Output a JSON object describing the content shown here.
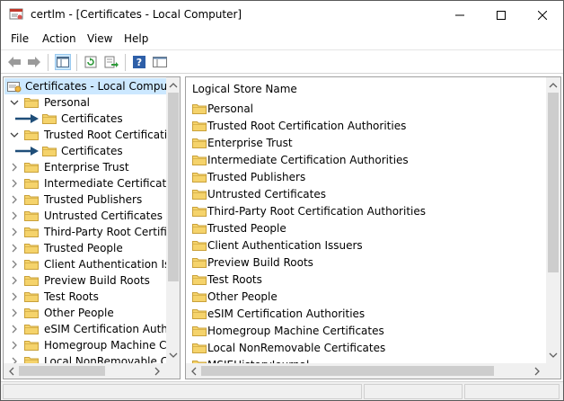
{
  "window": {
    "title": "certlm - [Certificates - Local Computer]"
  },
  "menu": {
    "file": "File",
    "action": "Action",
    "view": "View",
    "help": "Help"
  },
  "toolbar": {
    "icons": [
      "back-arrow-icon",
      "forward-arrow-icon",
      "show-tree-icon",
      "refresh-icon",
      "export-list-icon",
      "help-icon",
      "properties-icon"
    ]
  },
  "tree": {
    "root": "Certificates - Local Computer",
    "items": [
      {
        "label": "Personal",
        "expanded": true
      },
      {
        "label": "Certificates",
        "child": true,
        "annotated": true
      },
      {
        "label": "Trusted Root Certification",
        "expanded": true
      },
      {
        "label": "Certificates",
        "child": true,
        "annotated": true
      },
      {
        "label": "Enterprise Trust"
      },
      {
        "label": "Intermediate Certification"
      },
      {
        "label": "Trusted Publishers"
      },
      {
        "label": "Untrusted Certificates"
      },
      {
        "label": "Third-Party Root Certificat"
      },
      {
        "label": "Trusted People"
      },
      {
        "label": "Client Authentication Issu"
      },
      {
        "label": "Preview Build Roots"
      },
      {
        "label": "Test Roots"
      },
      {
        "label": "Other People"
      },
      {
        "label": "eSIM Certification Authori"
      },
      {
        "label": "Homegroup Machine Cer"
      },
      {
        "label": "Local NonRemovable Certi"
      }
    ]
  },
  "list": {
    "column_header": "Logical Store Name",
    "items": [
      "Personal",
      "Trusted Root Certification Authorities",
      "Enterprise Trust",
      "Intermediate Certification Authorities",
      "Trusted Publishers",
      "Untrusted Certificates",
      "Third-Party Root Certification Authorities",
      "Trusted People",
      "Client Authentication Issuers",
      "Preview Build Roots",
      "Test Roots",
      "Other People",
      "eSIM Certification Authorities",
      "Homegroup Machine Certificates",
      "Local NonRemovable Certificates",
      "MSIEHistoryJournal"
    ]
  },
  "colors": {
    "selection": "#cce8ff",
    "folder": "#f5d36b",
    "folder_edge": "#c9a13a",
    "annotation_arrow": "#1f4e79"
  }
}
